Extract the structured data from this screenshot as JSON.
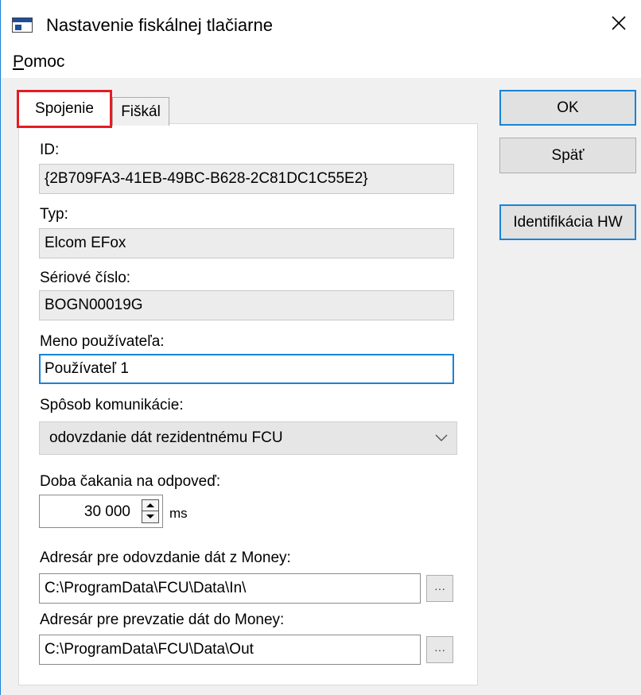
{
  "window": {
    "title": "Nastavenie fiskálnej tlačiarne",
    "close_glyph": "✕"
  },
  "menu": {
    "help_first": "P",
    "help_rest": "omoc"
  },
  "tabs": [
    {
      "label": "Spojenie",
      "active": true
    },
    {
      "label": "Fiškál",
      "active": false
    }
  ],
  "form": {
    "id_label": "ID:",
    "id_value": "{2B709FA3-41EB-49BC-B628-2C81DC1C55E2}",
    "type_label": "Typ:",
    "type_value": "Elcom EFox",
    "serial_label": "Sériové číslo:",
    "serial_value": "BOGN00019G",
    "user_label": "Meno používateľa:",
    "user_value": "Používateľ 1",
    "comm_label": "Spôsob komunikácie:",
    "comm_value": "odovzdanie dát rezidentnému FCU",
    "timeout_label": "Doba čakania na odpoveď:",
    "timeout_value": "30 000",
    "timeout_unit": "ms",
    "in_dir_label": "Adresár pre odovzdanie dát z Money:",
    "in_dir_value": "C:\\ProgramData\\FCU\\Data\\In\\",
    "out_dir_label": "Adresár pre prevzatie dát do Money:",
    "out_dir_value": "C:\\ProgramData\\FCU\\Data\\Out",
    "browse_label": "···"
  },
  "buttons": {
    "ok": "OK",
    "back": "Späť",
    "hw_id": "Identifikácia HW"
  },
  "colors": {
    "focus_blue": "#1883d7",
    "tab_highlight_red": "#e51c23",
    "window_bg": "#f0f0f0"
  }
}
